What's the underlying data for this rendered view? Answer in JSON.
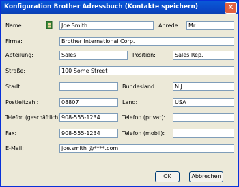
{
  "window": {
    "title": "Konfiguration Brother Adressbuch (Kontakte speichern)",
    "close_glyph": "✕"
  },
  "labels": {
    "name": "Name:",
    "anrede": "Anrede:",
    "firma": "Firma:",
    "abteilung": "Abteilung:",
    "position": "Position:",
    "strasse": "Straße:",
    "stadt": "Stadt:",
    "bundesland": "Bundesland:",
    "postleitzahl": "Postleitzahl:",
    "land": "Land:",
    "telefon_geschaeftlich": "Telefon (geschäftlich):",
    "telefon_privat": "Telefon (privat):",
    "fax": "Fax:",
    "telefon_mobil": "Telefon (mobil):",
    "email": "E-Mail:"
  },
  "values": {
    "name": "Joe Smith",
    "anrede": "Mr.",
    "firma": "Brother International Corp.",
    "abteilung": "Sales",
    "position": "Sales Rep.",
    "strasse": "100 Some Street",
    "stadt": "",
    "bundesland": "N.J.",
    "postleitzahl": "08807",
    "land": "USA",
    "telefon_geschaeftlich": "908-555-1234",
    "telefon_privat": "",
    "fax": "908-555-1234",
    "telefon_mobil": "",
    "email": "joe.smith @****.com"
  },
  "icons": {
    "name_picker": "address-book-icon"
  },
  "buttons": {
    "ok": "OK",
    "cancel": "Abbrechen"
  },
  "colors": {
    "titlebar": "#0a48c8",
    "window_bg": "#ece9d8",
    "field_border": "#7f9db9"
  }
}
